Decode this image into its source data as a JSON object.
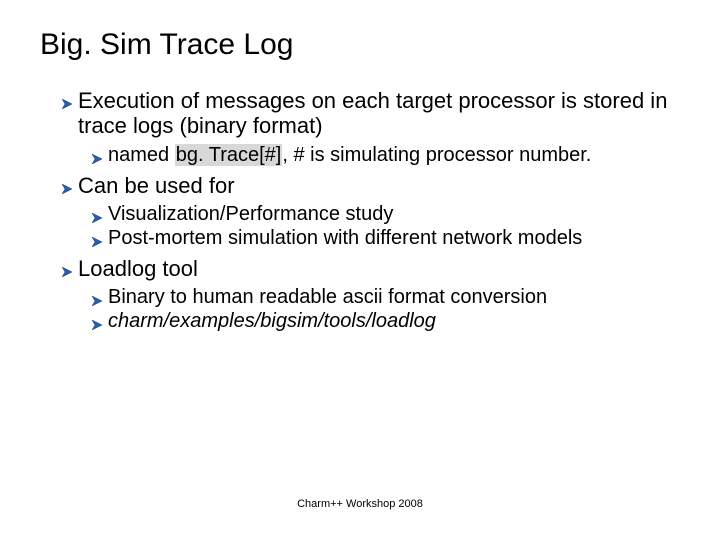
{
  "title": "Big. Sim Trace Log",
  "items": [
    {
      "text": "Execution of messages on each target processor is stored in trace logs (binary format)",
      "sub": [
        {
          "prefix": "named ",
          "code": "bg. Trace[#]",
          "suffix": ", # is simulating processor number."
        }
      ]
    },
    {
      "text": "Can be used for",
      "sub": [
        {
          "text": "Visualization/Performance study"
        },
        {
          "text": "Post-mortem simulation with different network models"
        }
      ]
    },
    {
      "text": "Loadlog tool",
      "sub": [
        {
          "text": "Binary to human readable ascii format conversion"
        },
        {
          "text_italic": "charm/examples/bigsim/tools/loadlog"
        }
      ]
    }
  ],
  "footer": "Charm++ Workshop 2008",
  "colors": {
    "bullet_fill": "#2a5db0",
    "bullet_stroke": "#14386f"
  }
}
